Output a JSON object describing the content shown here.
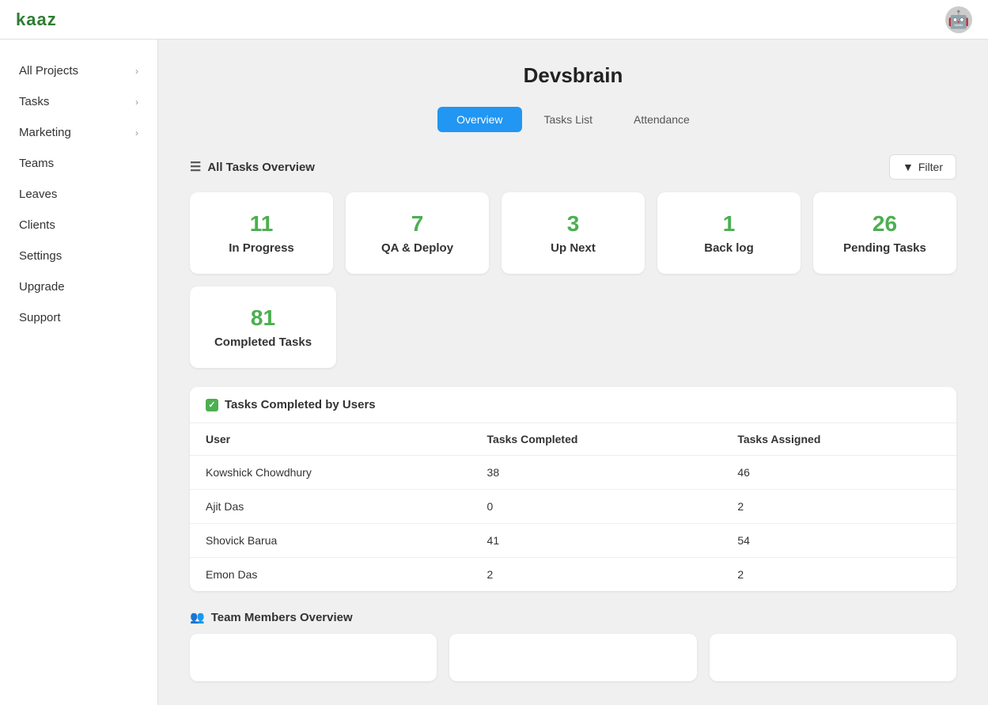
{
  "header": {
    "logo": "kaaz",
    "avatar_icon": "👤"
  },
  "sidebar": {
    "items": [
      {
        "label": "All Projects",
        "has_chevron": true
      },
      {
        "label": "Tasks",
        "has_chevron": true
      },
      {
        "label": "Marketing",
        "has_chevron": true
      },
      {
        "label": "Teams",
        "has_chevron": false
      },
      {
        "label": "Leaves",
        "has_chevron": false
      },
      {
        "label": "Clients",
        "has_chevron": false
      },
      {
        "label": "Settings",
        "has_chevron": false
      },
      {
        "label": "Upgrade",
        "has_chevron": false
      },
      {
        "label": "Support",
        "has_chevron": false
      }
    ]
  },
  "main": {
    "title": "Devsbrain",
    "tabs": [
      {
        "label": "Overview",
        "active": true
      },
      {
        "label": "Tasks List",
        "active": false
      },
      {
        "label": "Attendance",
        "active": false
      }
    ],
    "all_tasks_section": {
      "label": "All Tasks Overview",
      "filter_label": "Filter",
      "stats": [
        {
          "number": "11",
          "label": "In Progress"
        },
        {
          "number": "7",
          "label": "QA & Deploy"
        },
        {
          "number": "3",
          "label": "Up Next"
        },
        {
          "number": "1",
          "label": "Back log"
        },
        {
          "number": "26",
          "label": "Pending Tasks"
        }
      ],
      "completed": {
        "number": "81",
        "label": "Completed Tasks"
      }
    },
    "tasks_by_users": {
      "label": "Tasks Completed by Users",
      "columns": [
        "User",
        "Tasks Completed",
        "Tasks Assigned"
      ],
      "rows": [
        {
          "user": "Kowshick Chowdhury",
          "completed": "38",
          "assigned": "46"
        },
        {
          "user": "Ajit Das",
          "completed": "0",
          "assigned": "2"
        },
        {
          "user": "Shovick Barua",
          "completed": "41",
          "assigned": "54"
        },
        {
          "user": "Emon Das",
          "completed": "2",
          "assigned": "2"
        }
      ]
    },
    "team_members": {
      "label": "Team Members Overview",
      "icon": "👥",
      "cards": [
        {},
        {},
        {}
      ]
    }
  }
}
